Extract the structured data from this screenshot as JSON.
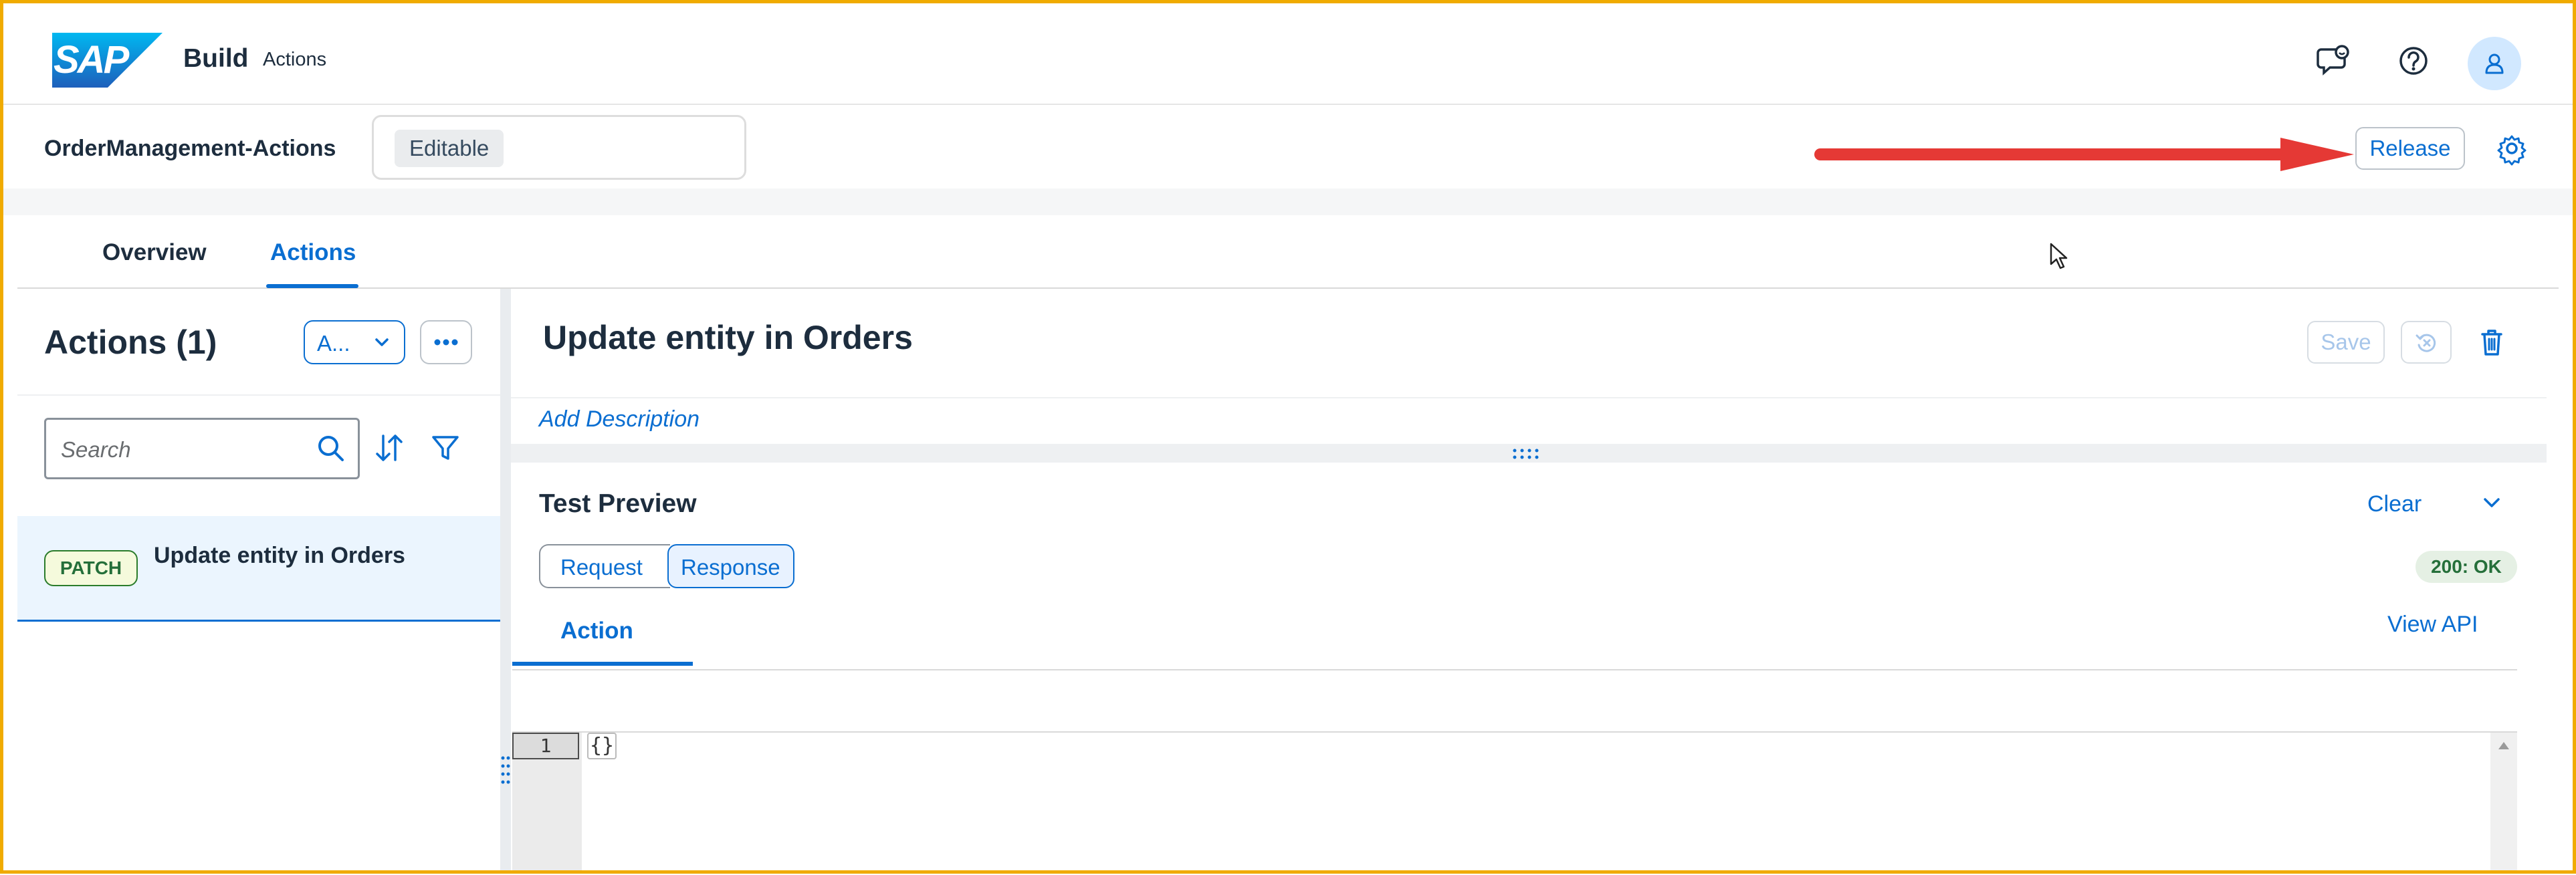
{
  "shell": {
    "logo_text": "SAP",
    "product": "Build",
    "section": "Actions",
    "icons": [
      "feedback-icon",
      "help-icon",
      "user-icon"
    ]
  },
  "header": {
    "project_name": "OrderManagement-Actions",
    "status_chip": "Editable",
    "release_label": "Release"
  },
  "tabs": [
    {
      "label": "Overview"
    },
    {
      "label": "Actions",
      "selected": true
    }
  ],
  "actions_list": {
    "title": "Actions (1)",
    "filter_select": "A...",
    "search_placeholder": "Search",
    "items": [
      {
        "method": "PATCH",
        "title": "Update entity in Orders"
      }
    ]
  },
  "detail": {
    "title": "Update entity in Orders",
    "save_label": "Save",
    "add_description": "Add Description"
  },
  "test_preview": {
    "title": "Test Preview",
    "clear_label": "Clear",
    "segments": [
      "Request",
      "Response"
    ],
    "selected_segment": "Response",
    "status": "200: OK",
    "subtab": "Action",
    "view_api": "View API",
    "editor": {
      "line_number": "1",
      "code": "{}"
    }
  },
  "colors": {
    "accent": "#0a6ed1",
    "frame": "#f0ab00",
    "annotation_arrow": "#e53935",
    "patch_badge_bg": "#f5fadc",
    "status_bg": "#e5f0e4"
  }
}
